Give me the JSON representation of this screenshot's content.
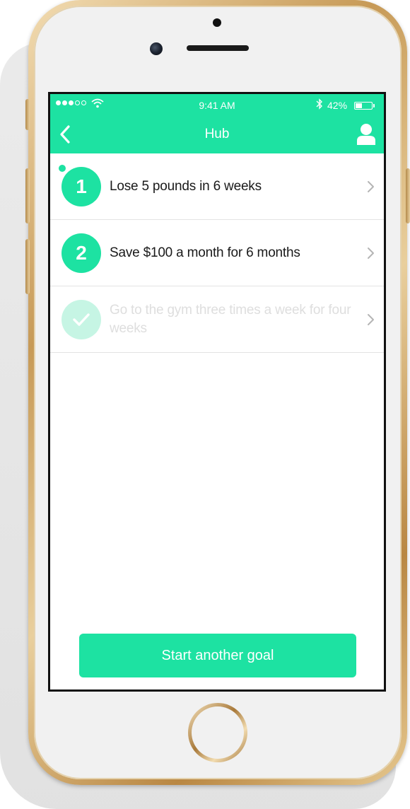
{
  "status_bar": {
    "time": "9:41 AM",
    "battery_percent": "42%",
    "battery_level": 0.42,
    "signal_bars_filled": 3,
    "signal_bars_total": 5
  },
  "nav": {
    "title": "Hub",
    "back_icon": "chevron-left-icon",
    "profile_icon": "user-icon"
  },
  "goals": [
    {
      "number": "1",
      "text": "Lose 5 pounds in 6 weeks",
      "status": "active",
      "new_indicator": true
    },
    {
      "number": "2",
      "text": "Save $100 a month for 6 months",
      "status": "active",
      "new_indicator": false
    },
    {
      "number": "",
      "text": "Go to the gym three times a week for four weeks",
      "status": "completed",
      "new_indicator": false
    }
  ],
  "cta": {
    "label": "Start another goal"
  },
  "colors": {
    "accent": "#1de2a2",
    "accent_faded": "#c6f5e4",
    "completed_text": "#dedede"
  }
}
